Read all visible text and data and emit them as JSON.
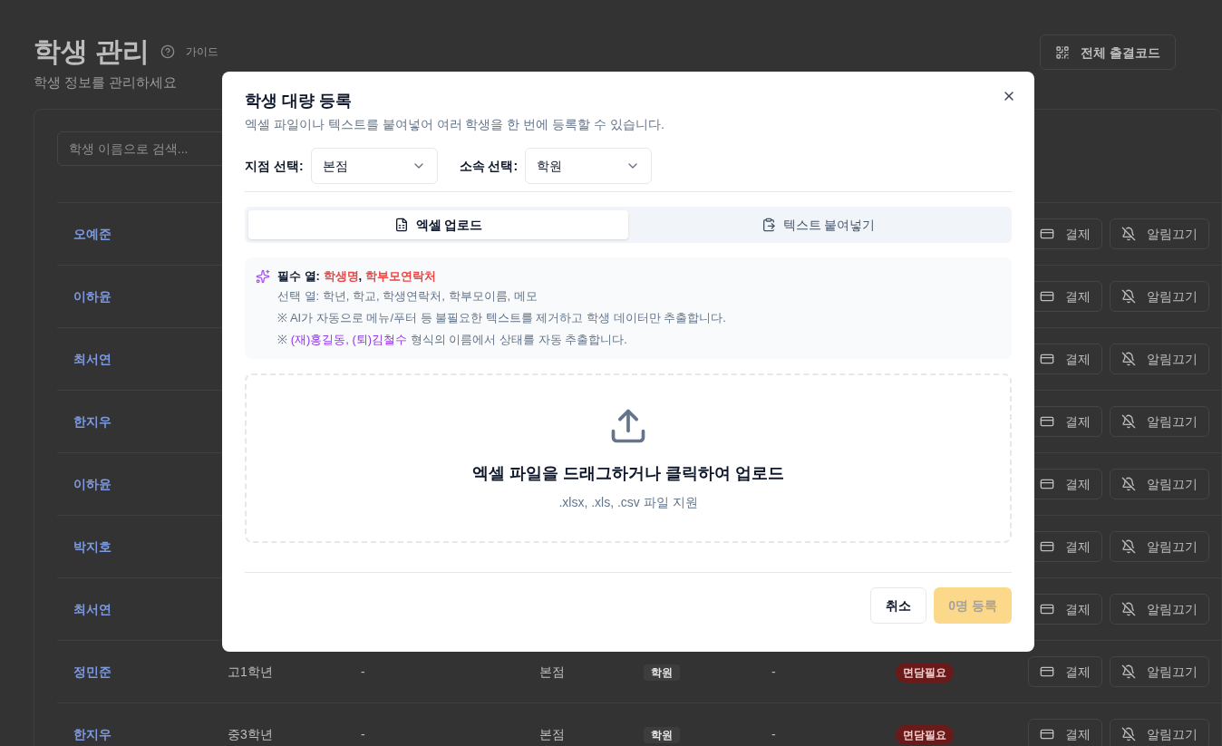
{
  "page": {
    "title": "학생 관리",
    "guide": "가이드",
    "subtitle": "학생 정보를 관리하세요",
    "attendance_button": "전체 출결코드",
    "search": {
      "placeholder": "학생 이름으로 검색..."
    }
  },
  "rows": [
    {
      "name": "오예준",
      "actions": [
        "결제",
        "알림끄기"
      ]
    },
    {
      "name": "이하윤",
      "actions": [
        "결제",
        "알림끄기"
      ]
    },
    {
      "name": "최서연",
      "actions": [
        "결제",
        "알림끄기"
      ]
    },
    {
      "name": "한지우",
      "actions": [
        "결제",
        "알림끄기"
      ]
    },
    {
      "name": "이하윤",
      "actions": [
        "결제",
        "알림끄기"
      ]
    },
    {
      "name": "박지호",
      "actions": [
        "결제",
        "알림끄기"
      ]
    },
    {
      "name": "최서연",
      "actions": [
        "결제",
        "알림끄기"
      ]
    },
    {
      "name": "정민준",
      "grade": "고1학년",
      "column_3": "-",
      "branch": "본점",
      "affiliation": "학원",
      "column_6": "-",
      "status": "면담필요",
      "actions": [
        "결제",
        "알림끄기"
      ]
    },
    {
      "name": "한지우",
      "grade": "중3학년",
      "column_3": "-",
      "branch": "본점",
      "affiliation": "학원",
      "column_6": "-",
      "status": "면담필요",
      "actions": [
        "결제",
        "알림끄기"
      ]
    }
  ],
  "dialog": {
    "title": "학생 대량 등록",
    "description": "엑셀 파일이나 텍스트를 붙여넣어 여러 학생을 한 번에 등록할 수 있습니다.",
    "selects": [
      {
        "label": "지점 선택:",
        "value": "본점"
      },
      {
        "label": "소속 선택:",
        "value": "학원"
      }
    ],
    "tabs": [
      {
        "label": "엑셀 업로드",
        "kind": "excel",
        "selected": true
      },
      {
        "label": "텍스트 붙여넣기",
        "kind": "paste",
        "selected": false
      }
    ],
    "info_lines": [
      [
        {
          "text": "필수 열: ",
          "kind": "label"
        },
        {
          "text": "학생명",
          "kind": "required"
        },
        {
          "text": ", ",
          "kind": "label"
        },
        {
          "text": "학부모연락처",
          "kind": "required"
        }
      ],
      [
        {
          "text": "선택 열: 학년, 학교, 학생연락처, 학부모이름, 메모",
          "kind": "plain"
        }
      ],
      [
        {
          "text": "※ AI가 자동으로 메뉴/푸터 등 불필요한 텍스트를 제거하고 학생 데이터만 추출합니다.",
          "kind": "plain"
        }
      ],
      [
        {
          "text": "※ ",
          "kind": "plain"
        },
        {
          "text": "(재)홍길동, ",
          "kind": "example"
        },
        {
          "text": "(퇴)김철수",
          "kind": "example"
        },
        {
          "text": " 형식의 이름에서 상태를 자동 추출합니다.",
          "kind": "plain"
        }
      ]
    ],
    "dropzone": {
      "title": "엑셀 파일을 드래그하거나 클릭하여 업로드",
      "hint": ".xlsx, .xls, .csv 파일 지원"
    },
    "cancel": "취소",
    "submit": {
      "label": "0명 등록",
      "disabled": true
    }
  }
}
